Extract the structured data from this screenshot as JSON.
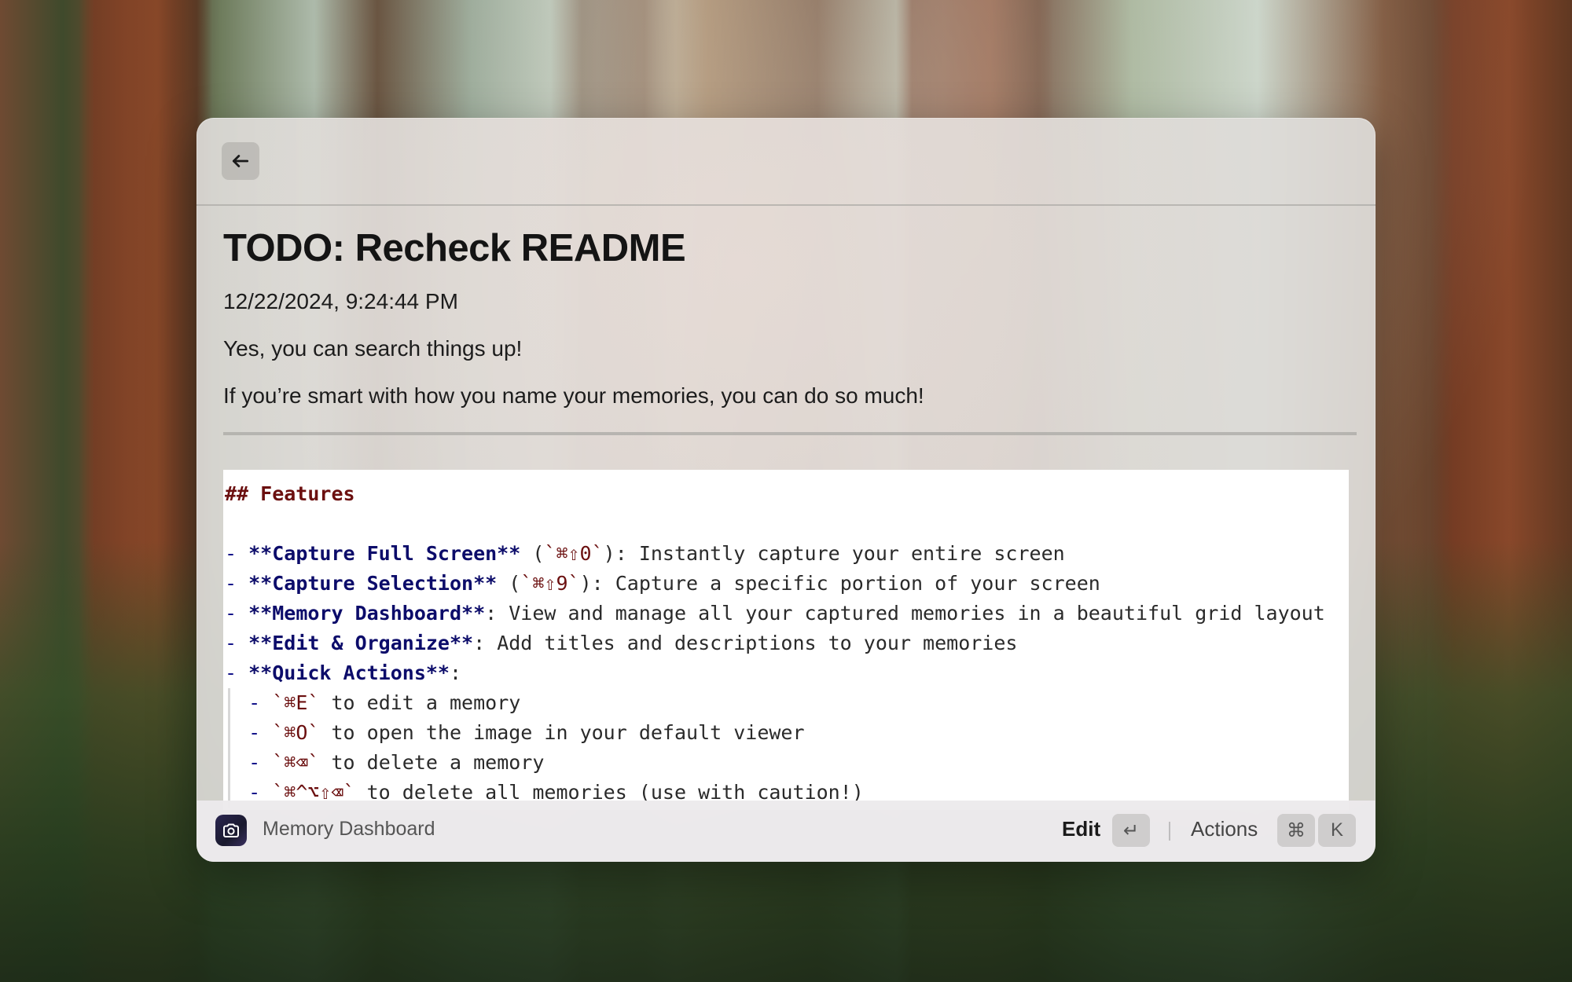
{
  "window": {
    "back_icon": "arrow-left-icon"
  },
  "memory": {
    "title": "TODO: Recheck README",
    "timestamp": "12/22/2024, 9:24:44 PM",
    "paragraph_1": "Yes, you can search things up!",
    "paragraph_2": "If you’re smart with how you name your memories, you can do so much!"
  },
  "code_block": {
    "heading": "## Features",
    "items": [
      {
        "bullet": "- ",
        "bold": "**Capture Full Screen**",
        "pre": " (",
        "code": "`⌘⇧0`",
        "post": "): Instantly capture your entire screen"
      },
      {
        "bullet": "- ",
        "bold": "**Capture Selection**",
        "pre": " (",
        "code": "`⌘⇧9`",
        "post": "): Capture a specific portion of your screen"
      },
      {
        "bullet": "- ",
        "bold": "**Memory Dashboard**",
        "pre": "",
        "code": "",
        "post": ": View and manage all your captured memories in a beautiful grid layout"
      },
      {
        "bullet": "- ",
        "bold": "**Edit & Organize**",
        "pre": "",
        "code": "",
        "post": ": Add titles and descriptions to your memories"
      },
      {
        "bullet": "- ",
        "bold": "**Quick Actions**",
        "pre": "",
        "code": "",
        "post": ":"
      }
    ],
    "sub_items": [
      {
        "bullet": "- ",
        "code": "`⌘E`",
        "text": " to edit a memory"
      },
      {
        "bullet": "- ",
        "code": "`⌘O`",
        "text": " to open the image in your default viewer"
      },
      {
        "bullet": "- ",
        "code": "`⌘⌫`",
        "text": " to delete a memory"
      },
      {
        "bullet": "- ",
        "code": "`⌘^⌥⇧⌫`",
        "text": " to delete all memories (use with caution!)"
      }
    ]
  },
  "footer": {
    "app_icon": "camera-icon",
    "app_name": "Memory Dashboard",
    "edit_label": "Edit",
    "enter_key": "↵",
    "actions_label": "Actions",
    "cmd_key": "⌘",
    "k_key": "K"
  }
}
